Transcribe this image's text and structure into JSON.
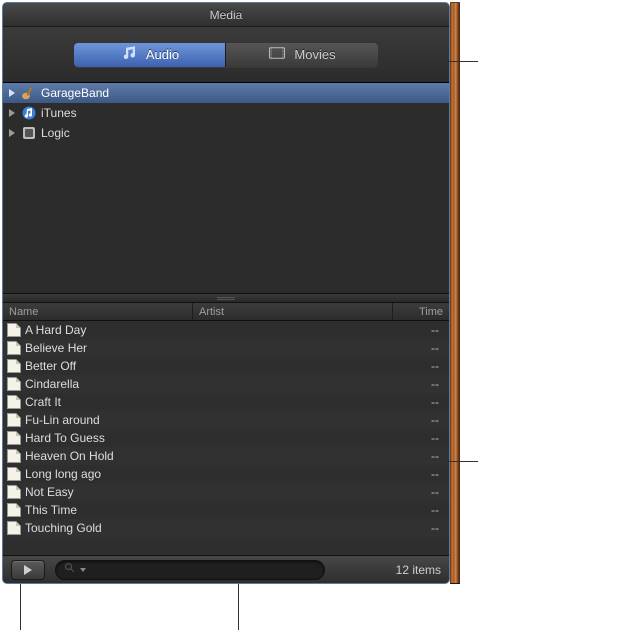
{
  "window": {
    "title": "Media"
  },
  "tabs": {
    "audio": {
      "label": "Audio"
    },
    "movies": {
      "label": "Movies"
    }
  },
  "sources": [
    {
      "name": "GarageBand",
      "icon": "guitar",
      "selected": true
    },
    {
      "name": "iTunes",
      "icon": "itunes",
      "selected": false
    },
    {
      "name": "Logic",
      "icon": "logic",
      "selected": false
    }
  ],
  "columns": {
    "name": "Name",
    "artist": "Artist",
    "time": "Time"
  },
  "tracks": [
    {
      "name": "A Hard Day",
      "artist": "",
      "time": "--"
    },
    {
      "name": "Believe Her",
      "artist": "",
      "time": "--"
    },
    {
      "name": "Better Off",
      "artist": "",
      "time": "--"
    },
    {
      "name": "Cindarella",
      "artist": "",
      "time": "--"
    },
    {
      "name": "Craft It",
      "artist": "",
      "time": "--"
    },
    {
      "name": "Fu-Lin around",
      "artist": "",
      "time": "--"
    },
    {
      "name": "Hard To Guess",
      "artist": "",
      "time": "--"
    },
    {
      "name": "Heaven On Hold",
      "artist": "",
      "time": "--"
    },
    {
      "name": "Long long ago",
      "artist": "",
      "time": "--"
    },
    {
      "name": "Not Easy",
      "artist": "",
      "time": "--"
    },
    {
      "name": "This Time",
      "artist": "",
      "time": "--"
    },
    {
      "name": "Touching Gold",
      "artist": "",
      "time": "--"
    }
  ],
  "footer": {
    "search_placeholder": "",
    "item_count": "12 items"
  }
}
